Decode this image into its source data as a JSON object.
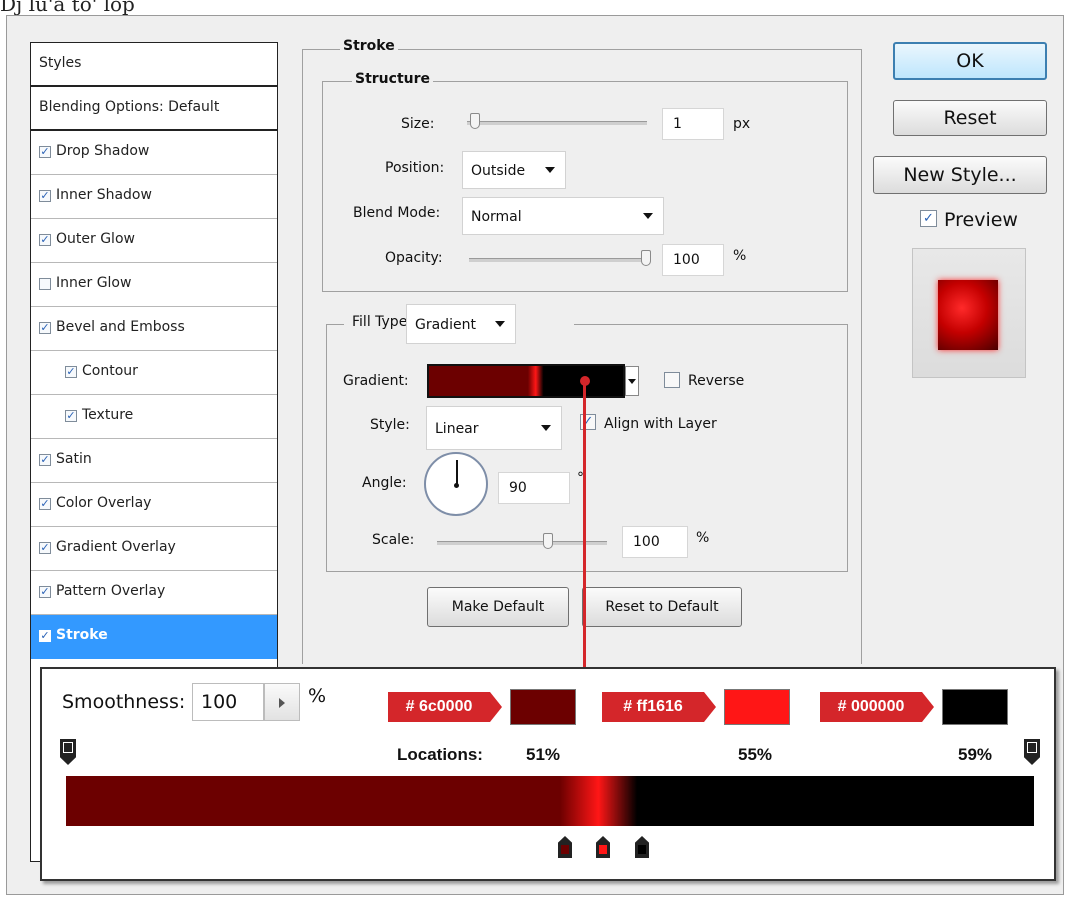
{
  "top_text": "Dj lu'a to' lop",
  "styles_panel": {
    "header": "Styles",
    "blending": "Blending Options: Default",
    "items": [
      {
        "label": "Drop Shadow",
        "checked": true,
        "indent": false,
        "selected": false
      },
      {
        "label": "Inner Shadow",
        "checked": true,
        "indent": false,
        "selected": false
      },
      {
        "label": "Outer Glow",
        "checked": true,
        "indent": false,
        "selected": false
      },
      {
        "label": "Inner Glow",
        "checked": false,
        "indent": false,
        "selected": false
      },
      {
        "label": "Bevel and Emboss",
        "checked": true,
        "indent": false,
        "selected": false
      },
      {
        "label": "Contour",
        "checked": true,
        "indent": true,
        "selected": false
      },
      {
        "label": "Texture",
        "checked": true,
        "indent": true,
        "selected": false
      },
      {
        "label": "Satin",
        "checked": true,
        "indent": false,
        "selected": false
      },
      {
        "label": "Color Overlay",
        "checked": true,
        "indent": false,
        "selected": false
      },
      {
        "label": "Gradient Overlay",
        "checked": true,
        "indent": false,
        "selected": false
      },
      {
        "label": "Pattern Overlay",
        "checked": true,
        "indent": false,
        "selected": false
      },
      {
        "label": "Stroke",
        "checked": true,
        "indent": false,
        "selected": true
      }
    ]
  },
  "stroke": {
    "title": "Stroke",
    "structure": {
      "title": "Structure",
      "size_label": "Size:",
      "size_value": "1",
      "size_unit": "px",
      "size_slider_fraction": 0.02,
      "position_label": "Position:",
      "position_value": "Outside",
      "blend_label": "Blend Mode:",
      "blend_value": "Normal",
      "opacity_label": "Opacity:",
      "opacity_value": "100",
      "opacity_unit": "%",
      "opacity_slider_fraction": 1.0
    },
    "fill": {
      "fill_type_label": "Fill Type:",
      "fill_type_value": "Gradient",
      "gradient_label": "Gradient:",
      "reverse_label": "Reverse",
      "reverse_checked": false,
      "style_label": "Style:",
      "style_value": "Linear",
      "align_label": "Align with Layer",
      "align_checked": true,
      "angle_label": "Angle:",
      "angle_value": "90",
      "angle_unit": "°",
      "scale_label": "Scale:",
      "scale_value": "100",
      "scale_unit": "%",
      "scale_slider_fraction": 0.66
    },
    "make_default": "Make Default",
    "reset_default": "Reset to Default"
  },
  "buttons": {
    "ok": "OK",
    "reset": "Reset",
    "new_style": "New Style...",
    "preview_label": "Preview",
    "preview_checked": true
  },
  "gradient_editor": {
    "smoothness_label": "Smoothness:",
    "smoothness_value": "100",
    "smoothness_unit": "%",
    "locations_label": "Locations:",
    "stops": [
      {
        "hex": "# 6c0000",
        "color": "#6c0000",
        "location": "51%"
      },
      {
        "hex": "# ff1616",
        "color": "#ff1616",
        "location": "55%"
      },
      {
        "hex": "# 000000",
        "color": "#000000",
        "location": "59%"
      }
    ]
  },
  "colors": {
    "selection": "#3399ff",
    "annotation_red": "#d4262a",
    "dark_red": "#6c0000",
    "bright_red": "#ff1616"
  }
}
